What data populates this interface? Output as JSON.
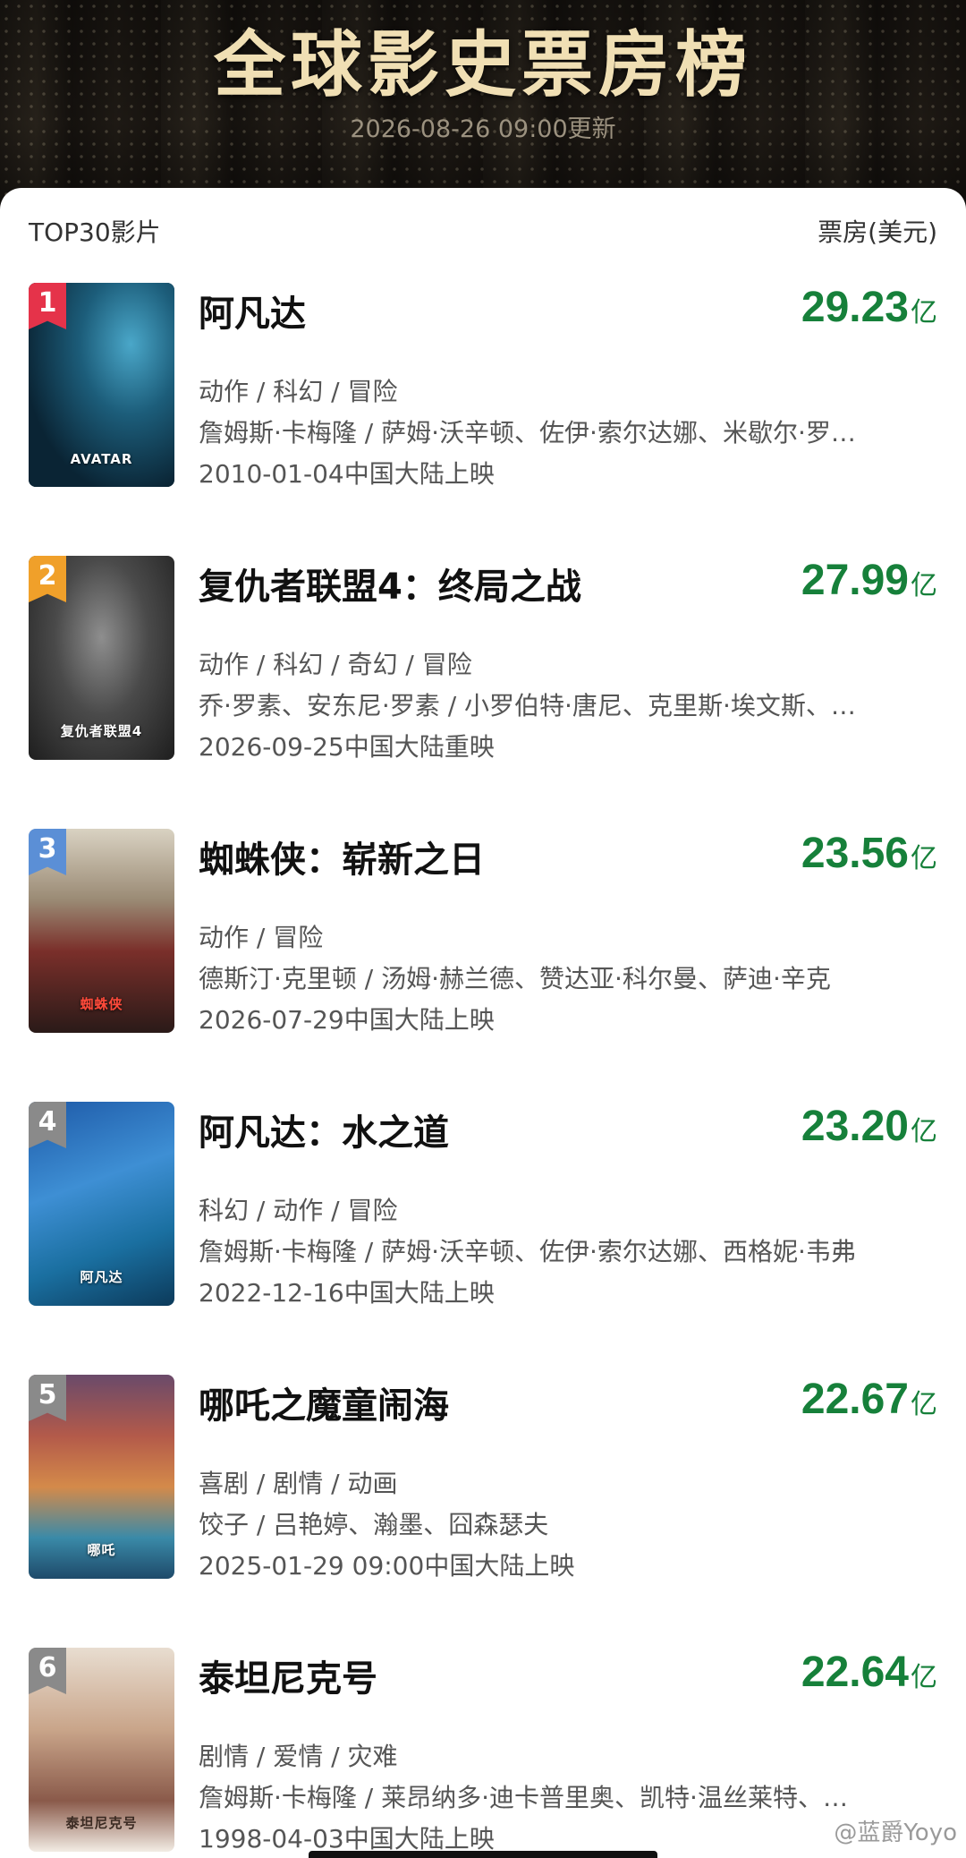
{
  "header": {
    "title": "全球影史票房榜",
    "updated": "2026-08-26 09:00更新"
  },
  "list": {
    "left_label": "TOP30影片",
    "right_label": "票房(美元)"
  },
  "unit": "亿",
  "colors": {
    "gross_green": "#16803a",
    "badge_red": "#e5334a",
    "badge_orange": "#f0a02a",
    "badge_blue": "#5b8fd6",
    "badge_gray": "#8a8a8a"
  },
  "movies": [
    {
      "rank": "1",
      "title": "阿凡达",
      "gross": "29.23",
      "genres": "动作 / 科幻 / 冒险",
      "cast": "詹姆斯·卡梅隆 / 萨姆·沃辛顿、佐伊·索尔达娜、米歇尔·罗…",
      "release": "2010-01-04中国大陆上映",
      "poster_text": "AVATAR"
    },
    {
      "rank": "2",
      "title": "复仇者联盟4：终局之战",
      "gross": "27.99",
      "genres": "动作 / 科幻 / 奇幻 / 冒险",
      "cast": "乔·罗素、安东尼·罗素 / 小罗伯特·唐尼、克里斯·埃文斯、…",
      "release": "2026-09-25中国大陆重映",
      "poster_text": "复仇者联盟4"
    },
    {
      "rank": "3",
      "title": "蜘蛛侠：崭新之日",
      "gross": "23.56",
      "genres": "动作 / 冒险",
      "cast": "德斯汀·克里顿 / 汤姆·赫兰德、赞达亚·科尔曼、萨迪·辛克",
      "release": "2026-07-29中国大陆上映",
      "poster_text": "蜘蛛侠"
    },
    {
      "rank": "4",
      "title": "阿凡达：水之道",
      "gross": "23.20",
      "genres": "科幻 / 动作 / 冒险",
      "cast": "詹姆斯·卡梅隆 / 萨姆·沃辛顿、佐伊·索尔达娜、西格妮·韦弗",
      "release": "2022-12-16中国大陆上映",
      "poster_text": "阿凡达"
    },
    {
      "rank": "5",
      "title": "哪吒之魔童闹海",
      "gross": "22.67",
      "genres": "喜剧 / 剧情 / 动画",
      "cast": "饺子 / 吕艳婷、瀚墨、囧森瑟夫",
      "release": "2025-01-29 09:00中国大陆上映",
      "poster_text": "哪吒"
    },
    {
      "rank": "6",
      "title": "泰坦尼克号",
      "gross": "22.64",
      "genres": "剧情 / 爱情 / 灾难",
      "cast": "詹姆斯·卡梅隆 / 莱昂纳多·迪卡普里奥、凯特·温丝莱特、…",
      "release": "1998-04-03中国大陆上映",
      "poster_text": "泰坦尼克号"
    }
  ],
  "watermark": "@蓝爵Yoyo"
}
